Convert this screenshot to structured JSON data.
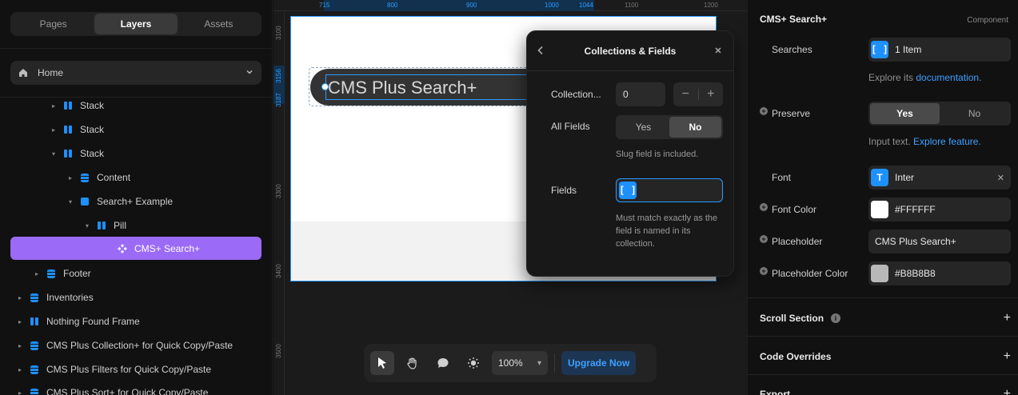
{
  "left_panel": {
    "tabs": [
      "Pages",
      "Layers",
      "Assets"
    ],
    "active_tab": "Layers",
    "page_select": "Home",
    "tree": [
      {
        "label": "Stack",
        "icon": "stack-icon"
      },
      {
        "label": "Stack",
        "icon": "stack-icon"
      },
      {
        "label": "Stack",
        "icon": "stack-icon"
      },
      {
        "label": "Content",
        "icon": "cms-collection-icon"
      },
      {
        "label": "Search+ Example",
        "icon": "frame-icon"
      },
      {
        "label": "Pill",
        "icon": "stack-icon"
      },
      {
        "label": "CMS+ Search+",
        "icon": "component-icon"
      },
      {
        "label": "Footer",
        "icon": "cms-collection-icon"
      },
      {
        "label": "Inventories",
        "icon": "cms-collection-icon"
      },
      {
        "label": "Nothing Found Frame",
        "icon": "stack-icon"
      },
      {
        "label": "CMS Plus Collection+ for Quick Copy/Paste",
        "icon": "cms-collection-icon"
      },
      {
        "label": "CMS Plus Filters for Quick Copy/Paste",
        "icon": "cms-collection-icon"
      },
      {
        "label": "CMS Plus Sort+ for Quick Copy/Paste",
        "icon": "cms-collection-icon"
      }
    ]
  },
  "canvas": {
    "ruler_top": [
      "715",
      "800",
      "900",
      "1000",
      "1044",
      "1100",
      "1200"
    ],
    "ruler_left": [
      "3100",
      "3156",
      "3187",
      "3300",
      "3400",
      "3500"
    ],
    "search_placeholder": "CMS Plus Search+"
  },
  "popover": {
    "title": "Collections & Fields",
    "collection_label": "Collection...",
    "collection_value": "0",
    "stepper_minus": "−",
    "stepper_plus": "+",
    "all_fields_label": "All Fields",
    "yes": "Yes",
    "no": "No",
    "all_fields_selected": "No",
    "slug_hint": "Slug field is included.",
    "fields_label": "Fields",
    "fields_hint": "Must match exactly as the field is named in its collection."
  },
  "toolbar": {
    "zoom": "100%",
    "upgrade": "Upgrade Now"
  },
  "right_panel": {
    "title": "CMS+ Search+",
    "tag": "Component",
    "searches_label": "Searches",
    "searches_value": "1 Item",
    "explore_text": "Explore its ",
    "explore_link": "documentation",
    "explore_end": ".",
    "preserve_label": "Preserve",
    "preserve_yes": "Yes",
    "preserve_no": "No",
    "input_text": "Input text. ",
    "input_link": "Explore feature.",
    "font_label": "Font",
    "font_value": "Inter",
    "font_color_label": "Font Color",
    "font_color_value": "#FFFFFF",
    "placeholder_label": "Placeholder",
    "placeholder_value": "CMS Plus Search+",
    "placeholder_color_label": "Placeholder Color",
    "placeholder_color_value": "#B8B8B8",
    "scroll_section": "Scroll Section",
    "code_overrides": "Code Overrides",
    "export": "Export"
  },
  "colors": {
    "accent_blue": "#1e90ff",
    "selection_purple": "#9b6bf7",
    "font_swatch": "#FFFFFF",
    "placeholder_swatch": "#B8B8B8"
  }
}
